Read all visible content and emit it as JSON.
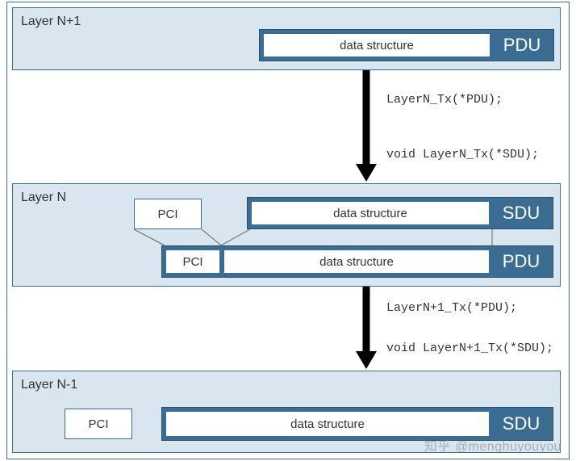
{
  "layers": {
    "top": {
      "label": "Layer N+1"
    },
    "mid": {
      "label": "Layer N"
    },
    "bottom": {
      "label": "Layer N-1"
    }
  },
  "text": {
    "data_structure": "data structure",
    "pci": "PCI",
    "pdu": "PDU",
    "sdu": "SDU"
  },
  "calls": {
    "a_send": "LayerN_Tx(*PDU);",
    "a_recv": "void LayerN_Tx(*SDU);",
    "b_send": "LayerN+1_Tx(*PDU);",
    "b_recv": "void LayerN+1_Tx(*SDU);"
  },
  "watermark": "知乎 @menghuyouyou"
}
